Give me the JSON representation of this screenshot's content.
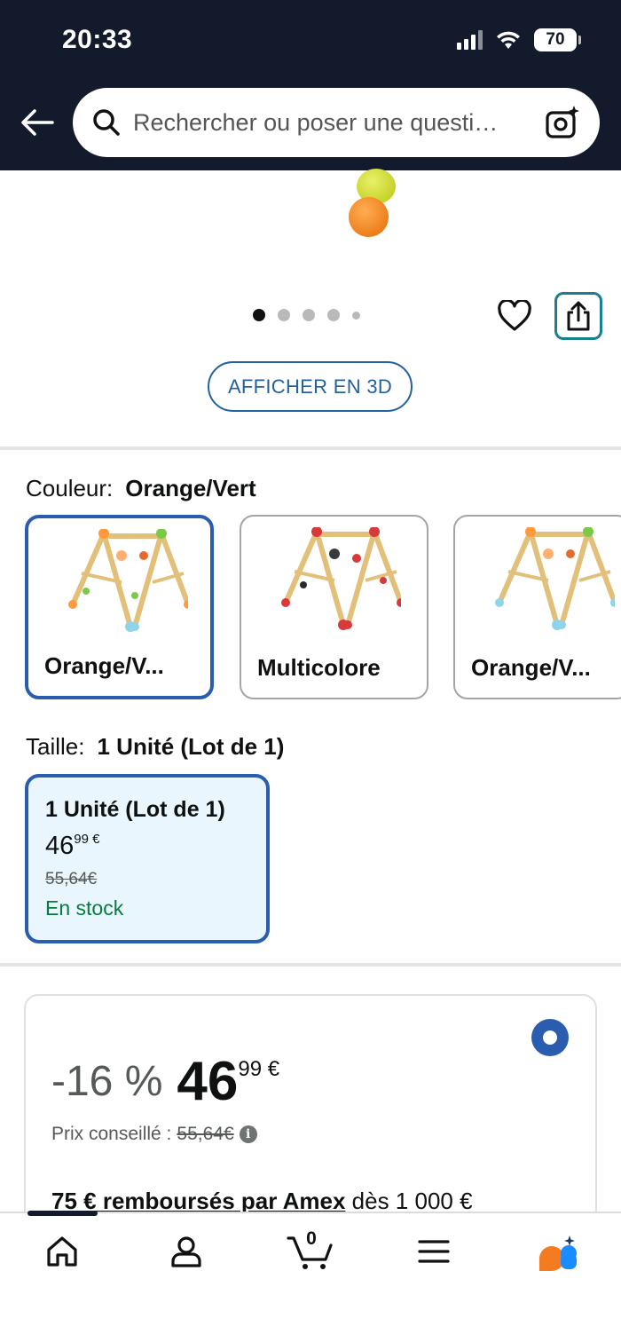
{
  "status_bar": {
    "time": "20:33",
    "battery": "70"
  },
  "header": {
    "back_icon": "arrow-left-icon",
    "search_placeholder": "Rechercher ou poser une questi…",
    "camera_icon": "camera-sparkle-icon"
  },
  "gallery": {
    "dots_total": 5,
    "active_dot": 1,
    "view_3d_label": "AFFICHER EN 3D"
  },
  "color_section": {
    "label": "Couleur:",
    "selected": "Orange/Vert",
    "options": [
      {
        "label": "Orange/V..."
      },
      {
        "label": "Multicolore"
      },
      {
        "label": "Orange/V..."
      }
    ]
  },
  "size_section": {
    "label": "Taille:",
    "selected": "1 Unité (Lot de 1)",
    "option": {
      "title": "1 Unité (Lot de 1)",
      "price_whole": "46",
      "price_frac": "99 €",
      "old_price": "55,64€",
      "stock": "En stock"
    }
  },
  "buy_box": {
    "discount": "-16 %",
    "price_whole": "46",
    "price_frac": "99 €",
    "list_price_label": "Prix conseillé :",
    "list_price": "55,64€",
    "amex_bold": "75 € remboursés par Amex",
    "amex_rest": " dès 1 000 €"
  },
  "bottom_nav": {
    "cart_count": "0",
    "items": [
      "home-icon",
      "account-icon",
      "cart-icon",
      "menu-icon",
      "rufus-assistant-icon"
    ]
  },
  "colors": {
    "header_bg": "#131a2b",
    "accent_blue": "#2a5db0",
    "link_blue": "#2162a1",
    "teal": "#1b7f92",
    "stock_green": "#067d3a",
    "size_card_bg": "#eaf6fd"
  }
}
